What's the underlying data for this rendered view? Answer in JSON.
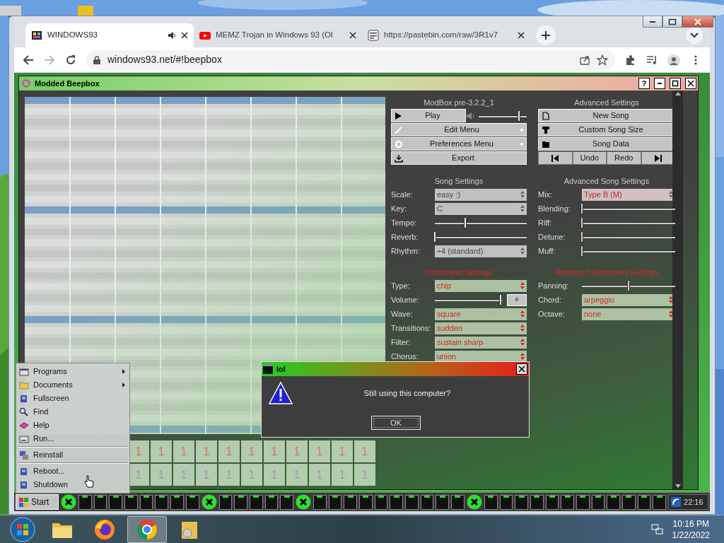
{
  "browser": {
    "tabs": [
      {
        "title": "WINDOWS93",
        "selected": true,
        "audio": true
      },
      {
        "title": "MEMZ Trojan in Windows 93 (Ol",
        "selected": false,
        "audio": false
      },
      {
        "title": "https://pastebin.com/raw/3R1v7",
        "selected": false,
        "audio": false
      }
    ],
    "url": "windows93.net/#!beepbox"
  },
  "beepbox": {
    "title": "Modded Beepbox",
    "help": "?",
    "version": "ModBox pre-3.2.2_1",
    "volume": {
      "level": 0.84
    },
    "menu_buttons": [
      {
        "label": "Play",
        "kind": "play"
      },
      {
        "label": "Edit Menu",
        "kind": "menu"
      },
      {
        "label": "Preferences Menu",
        "kind": "menu"
      },
      {
        "label": "Export",
        "kind": "button"
      }
    ],
    "advanced_title": "Advanced Settings",
    "advanced_buttons": [
      {
        "label": "New Song"
      },
      {
        "label": "Custom Song Size"
      },
      {
        "label": "Song Data"
      }
    ],
    "transport": [
      {
        "kind": "prev"
      },
      {
        "kind": "text",
        "label": "Undo"
      },
      {
        "kind": "text",
        "label": "Redo"
      },
      {
        "kind": "next"
      }
    ],
    "song_settings": {
      "title": "Song Settings",
      "rows": [
        {
          "label": "Scale:",
          "kind": "select",
          "value": "easy :)"
        },
        {
          "label": "Key:",
          "kind": "select",
          "value": "C"
        },
        {
          "label": "Tempo:",
          "kind": "slider",
          "level": 0.33
        },
        {
          "label": "Reverb:",
          "kind": "slider",
          "level": 0.0
        },
        {
          "label": "Rhythm:",
          "kind": "select",
          "value": "÷4 (standard)"
        }
      ]
    },
    "advanced_song_settings": {
      "title": "Advanced Song Settings",
      "rows": [
        {
          "label": "Mix:",
          "kind": "select",
          "value": "Type B (M)",
          "disabled": true
        },
        {
          "label": "Blending:",
          "kind": "slider",
          "level": 0.0,
          "disabled": false
        },
        {
          "label": "Riff:",
          "kind": "slider",
          "level": 0.0,
          "disabled": false
        },
        {
          "label": "Detune:",
          "kind": "slider",
          "level": 0.0,
          "disabled": false
        },
        {
          "label": "Muff:",
          "kind": "slider",
          "level": 0.0,
          "disabled": false
        }
      ]
    },
    "instrument_settings": {
      "title": "Instrument Settings",
      "rows": [
        {
          "label": "Type:",
          "kind": "select",
          "value": "chip"
        },
        {
          "label": "Volume:",
          "kind": "slider_button",
          "level": 0.97,
          "button": "e"
        },
        {
          "label": "Wave:",
          "kind": "select",
          "value": "square"
        },
        {
          "label": "Transitions:",
          "kind": "select",
          "value": "sudden"
        },
        {
          "label": "Filter:",
          "kind": "select",
          "value": "sustain sharp"
        },
        {
          "label": "Chorus:",
          "kind": "select",
          "value": "union"
        }
      ]
    },
    "advanced_instrument_settings": {
      "title": "Advanced Instrument Settings",
      "rows": [
        {
          "label": "Panning:",
          "kind": "slider",
          "level": 0.5
        },
        {
          "label": "Chord:",
          "kind": "select",
          "value": "arpeggio"
        },
        {
          "label": "Octave:",
          "kind": "select",
          "value": "none"
        }
      ]
    },
    "tracks": [
      {
        "color": "#e07060",
        "cells": [
          "1",
          "1",
          "1",
          "1",
          "1",
          "1",
          "1",
          "1",
          "1",
          "1",
          "1"
        ]
      },
      {
        "color": "#a890b8",
        "cells": [
          "1",
          "1",
          "1",
          "1",
          "1",
          "1",
          "1",
          "1",
          "1",
          "1",
          "1"
        ]
      }
    ]
  },
  "dialog": {
    "title": "lol",
    "message": "Still using this computer?",
    "button": "OK"
  },
  "start_menu": {
    "items": [
      {
        "label": "Programs",
        "submenu": true,
        "separator_before": false
      },
      {
        "label": "Documents",
        "submenu": true,
        "separator_before": false
      },
      {
        "label": "Fullscreen",
        "submenu": false,
        "separator_before": false
      },
      {
        "label": "Find",
        "submenu": false,
        "separator_before": false
      },
      {
        "label": "Help",
        "submenu": false,
        "separator_before": false
      },
      {
        "label": "Run...",
        "submenu": false,
        "separator_before": false
      },
      {
        "label": "Reinstall",
        "submenu": false,
        "separator_before": true
      },
      {
        "label": "Reboot...",
        "submenu": false,
        "separator_before": true
      },
      {
        "label": "Shutdown",
        "submenu": false,
        "separator_before": false
      }
    ]
  },
  "w93_taskbar": {
    "start": "Start",
    "clock": "22:16"
  },
  "win7_taskbar": {
    "apps": [
      {
        "selected": false
      },
      {
        "selected": false
      },
      {
        "selected": true
      },
      {
        "selected": false
      }
    ],
    "time": "10:16 PM",
    "date": "1/22/2022"
  }
}
